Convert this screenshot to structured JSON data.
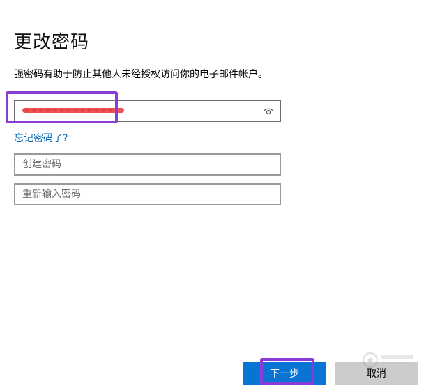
{
  "page": {
    "title": "更改密码",
    "description": "强密码有助于防止其他人未经授权访问你的电子邮件帐户。"
  },
  "form": {
    "current_password": {
      "masked_value": "•••••••••••••",
      "icon": "eye-icon"
    },
    "forgot_link": "忘记密码了?",
    "new_password": {
      "placeholder": "创建密码",
      "value": ""
    },
    "confirm_password": {
      "placeholder": "重新输入密码",
      "value": ""
    }
  },
  "buttons": {
    "next": "下一步",
    "cancel": "取消"
  },
  "colors": {
    "accent": "#0a74d4",
    "link": "#0067b8",
    "highlight": "#8a3dd6",
    "redaction": "#f04040",
    "secondary_button": "#cccccc"
  }
}
